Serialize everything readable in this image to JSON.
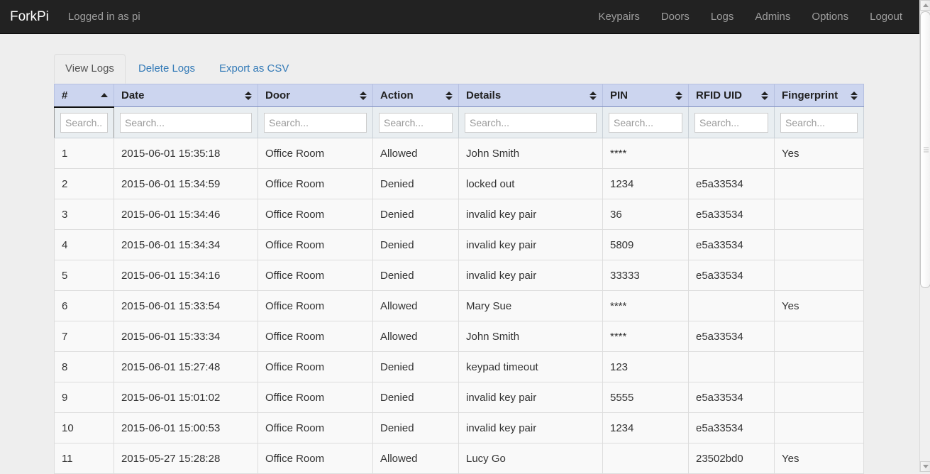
{
  "navbar": {
    "brand": "ForkPi",
    "user_status": "Logged in as pi",
    "links": [
      {
        "label": "Keypairs",
        "name": "keypairs"
      },
      {
        "label": "Doors",
        "name": "doors"
      },
      {
        "label": "Logs",
        "name": "logs"
      },
      {
        "label": "Admins",
        "name": "admins"
      },
      {
        "label": "Options",
        "name": "options"
      },
      {
        "label": "Logout",
        "name": "logout"
      }
    ],
    "background_color": "#222222",
    "link_color": "#9d9d9d"
  },
  "tabs": [
    {
      "label": "View Logs",
      "name": "view-logs",
      "active": true
    },
    {
      "label": "Delete Logs",
      "name": "delete-logs",
      "active": false
    },
    {
      "label": "Export as CSV",
      "name": "export-as-csv",
      "active": false
    }
  ],
  "table": {
    "sorted_column": "#",
    "sort_direction": "ascending",
    "header_background": "#ccd5ef",
    "columns": [
      {
        "label": "#",
        "key": "num",
        "sorted": true,
        "sort": "asc"
      },
      {
        "label": "Date",
        "key": "date",
        "sorted": false,
        "sort": "none"
      },
      {
        "label": "Door",
        "key": "door",
        "sorted": false,
        "sort": "none"
      },
      {
        "label": "Action",
        "key": "action",
        "sorted": false,
        "sort": "none"
      },
      {
        "label": "Details",
        "key": "details",
        "sorted": false,
        "sort": "none"
      },
      {
        "label": "PIN",
        "key": "pin",
        "sorted": false,
        "sort": "none"
      },
      {
        "label": "RFID UID",
        "key": "rfid",
        "sorted": false,
        "sort": "none"
      },
      {
        "label": "Fingerprint",
        "key": "fingerprint",
        "sorted": false,
        "sort": "none"
      }
    ],
    "search_row": {
      "num": {
        "value": "",
        "placeholder": "Search..."
      },
      "date": {
        "value": "",
        "placeholder": "Search..."
      },
      "door": {
        "value": "",
        "placeholder": "Search..."
      },
      "action": {
        "value": "",
        "placeholder": "Search..."
      },
      "details": {
        "value": "",
        "placeholder": "Search..."
      },
      "pin": {
        "value": "",
        "placeholder": "Search..."
      },
      "rfid": {
        "value": "",
        "placeholder": "Search..."
      },
      "fingerprint": {
        "value": "",
        "placeholder": "Search..."
      }
    },
    "rows": [
      {
        "num": "1",
        "date": "2015-06-01 15:35:18",
        "door": "Office Room",
        "action": "Allowed",
        "details": "John Smith",
        "pin": "****",
        "rfid": "",
        "fingerprint": "Yes"
      },
      {
        "num": "2",
        "date": "2015-06-01 15:34:59",
        "door": "Office Room",
        "action": "Denied",
        "details": "locked out",
        "pin": "1234",
        "rfid": "e5a33534",
        "fingerprint": ""
      },
      {
        "num": "3",
        "date": "2015-06-01 15:34:46",
        "door": "Office Room",
        "action": "Denied",
        "details": "invalid key pair",
        "pin": "36",
        "rfid": "e5a33534",
        "fingerprint": ""
      },
      {
        "num": "4",
        "date": "2015-06-01 15:34:34",
        "door": "Office Room",
        "action": "Denied",
        "details": "invalid key pair",
        "pin": "5809",
        "rfid": "e5a33534",
        "fingerprint": ""
      },
      {
        "num": "5",
        "date": "2015-06-01 15:34:16",
        "door": "Office Room",
        "action": "Denied",
        "details": "invalid key pair",
        "pin": "33333",
        "rfid": "e5a33534",
        "fingerprint": ""
      },
      {
        "num": "6",
        "date": "2015-06-01 15:33:54",
        "door": "Office Room",
        "action": "Allowed",
        "details": "Mary Sue",
        "pin": "****",
        "rfid": "",
        "fingerprint": "Yes"
      },
      {
        "num": "7",
        "date": "2015-06-01 15:33:34",
        "door": "Office Room",
        "action": "Allowed",
        "details": "John Smith",
        "pin": "****",
        "rfid": "e5a33534",
        "fingerprint": ""
      },
      {
        "num": "8",
        "date": "2015-06-01 15:27:48",
        "door": "Office Room",
        "action": "Denied",
        "details": "keypad timeout",
        "pin": "123",
        "rfid": "",
        "fingerprint": ""
      },
      {
        "num": "9",
        "date": "2015-06-01 15:01:02",
        "door": "Office Room",
        "action": "Denied",
        "details": "invalid key pair",
        "pin": "5555",
        "rfid": "e5a33534",
        "fingerprint": ""
      },
      {
        "num": "10",
        "date": "2015-06-01 15:00:53",
        "door": "Office Room",
        "action": "Denied",
        "details": "invalid key pair",
        "pin": "1234",
        "rfid": "e5a33534",
        "fingerprint": ""
      },
      {
        "num": "11",
        "date": "2015-05-27 15:28:28",
        "door": "Office Room",
        "action": "Allowed",
        "details": "Lucy Go",
        "pin": "",
        "rfid": "23502bd0",
        "fingerprint": "Yes"
      }
    ]
  },
  "scrollbar": {
    "orientation": "vertical",
    "up_arrow": "scroll-up",
    "down_arrow": "scroll-down"
  }
}
